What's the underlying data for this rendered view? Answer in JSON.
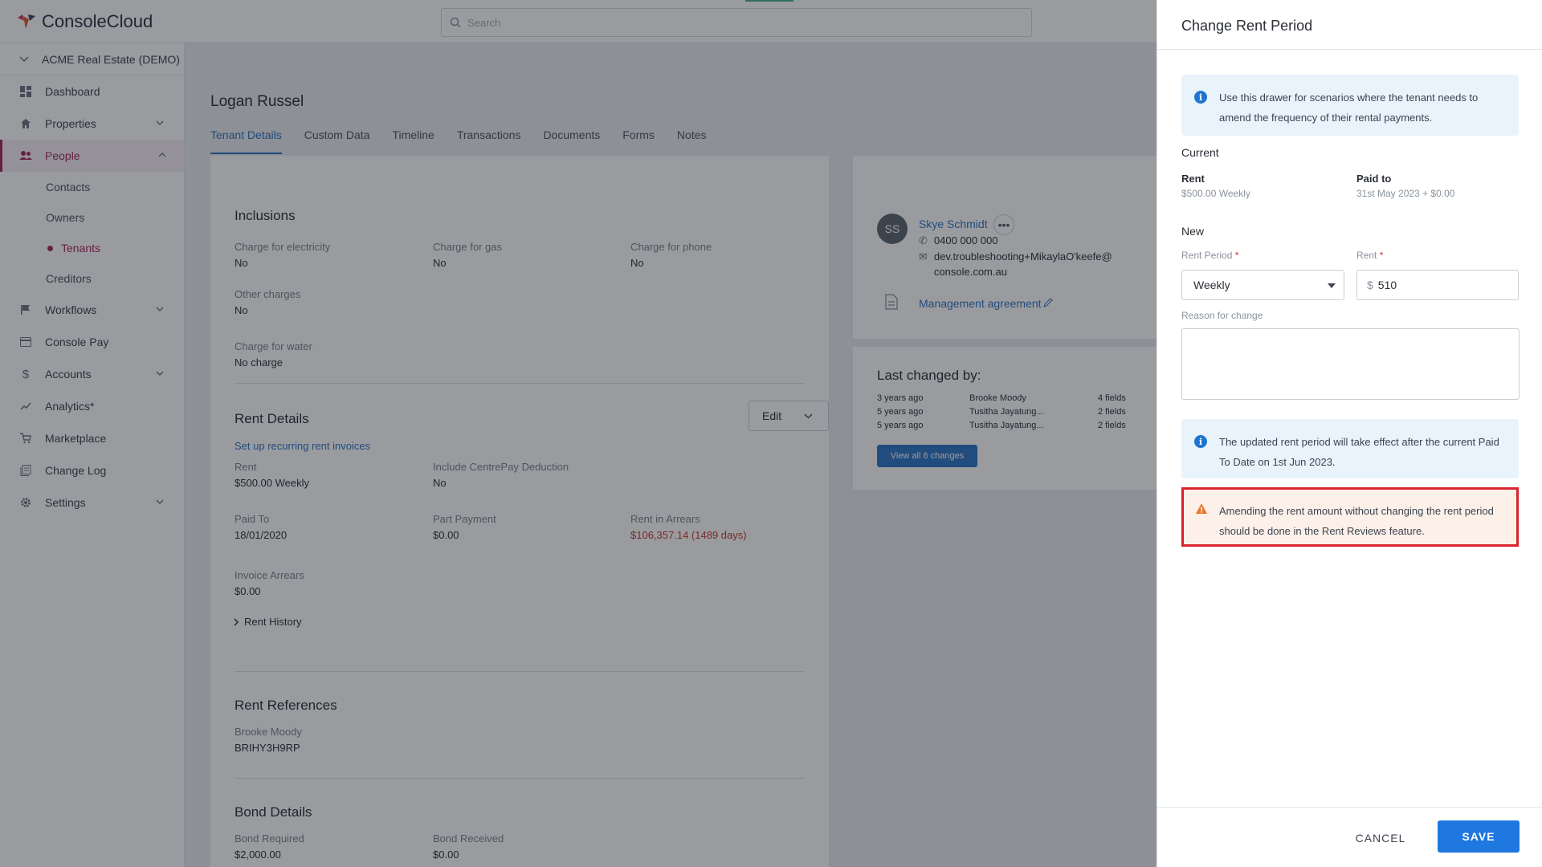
{
  "app": {
    "name": "ConsoleCloud"
  },
  "search": {
    "placeholder": "Search"
  },
  "sidebar": {
    "company": "ACME Real Estate (DEMO)",
    "items": [
      {
        "label": "Dashboard",
        "icon": "dashboard-icon"
      },
      {
        "label": "Properties",
        "icon": "home-icon"
      },
      {
        "label": "People",
        "icon": "people-icon"
      },
      {
        "label": "Workflows",
        "icon": "flag-icon"
      },
      {
        "label": "Console Pay",
        "icon": "card-icon"
      },
      {
        "label": "Accounts",
        "icon": "dollar-icon"
      },
      {
        "label": "Analytics*",
        "icon": "trend-icon"
      },
      {
        "label": "Marketplace",
        "icon": "cart-icon"
      },
      {
        "label": "Change Log",
        "icon": "log-icon"
      },
      {
        "label": "Settings",
        "icon": "gear-icon"
      }
    ],
    "people_sub": [
      "Contacts",
      "Owners",
      "Tenants",
      "Creditors"
    ]
  },
  "page": {
    "title": "Logan Russel",
    "tabs": [
      "Tenant Details",
      "Custom Data",
      "Timeline",
      "Transactions",
      "Documents",
      "Forms",
      "Notes"
    ]
  },
  "inclusions": {
    "title": "Inclusions",
    "electricity": {
      "label": "Charge for electricity",
      "value": "No"
    },
    "gas": {
      "label": "Charge for gas",
      "value": "No"
    },
    "phone": {
      "label": "Charge for phone",
      "value": "No"
    },
    "other": {
      "label": "Other charges",
      "value": "No"
    },
    "water": {
      "label": "Charge for water",
      "value": "No charge"
    }
  },
  "rent_details": {
    "title": "Rent Details",
    "edit_label": "Edit",
    "setup_link": "Set up recurring rent invoices",
    "rent": {
      "label": "Rent",
      "value": "$500.00 Weekly"
    },
    "centrepay": {
      "label": "Include CentrePay Deduction",
      "value": "No"
    },
    "paid_to": {
      "label": "Paid To",
      "value": "18/01/2020"
    },
    "part_payment": {
      "label": "Part Payment",
      "value": "$0.00"
    },
    "arrears": {
      "label": "Rent in Arrears",
      "value": "$106,357.14 (1489 days)"
    },
    "invoice_arrears": {
      "label": "Invoice Arrears",
      "value": "$0.00"
    },
    "history": "Rent History"
  },
  "rent_references": {
    "title": "Rent References",
    "name": "Brooke Moody",
    "ref": "BRIHY3H9RP"
  },
  "bond": {
    "title": "Bond Details",
    "required": {
      "label": "Bond Required",
      "value": "$2,000.00"
    },
    "received": {
      "label": "Bond Received",
      "value": "$0.00"
    }
  },
  "owners": {
    "initials": "SS",
    "name": "Skye Schmidt",
    "phone": "0400 000 000",
    "email_1": "dev.troubleshooting+MikaylaO'keefe@",
    "email_2": "console.com.au",
    "agreement": "Management agreement"
  },
  "last_changed": {
    "title": "Last changed by:",
    "rows": [
      {
        "when": "3 years ago",
        "who": "Brooke Moody",
        "fields": "4 fields"
      },
      {
        "when": "5 years ago",
        "who": "Tusitha Jayatung...",
        "fields": "2 fields"
      },
      {
        "when": "5 years ago",
        "who": "Tusitha Jayatung...",
        "fields": "2 fields"
      }
    ],
    "button": "View all 6 changes"
  },
  "drawer": {
    "title": "Change Rent Period",
    "info_1": "Use this drawer for scenarios where the tenant needs to amend the frequency of their rental payments.",
    "current_title": "Current",
    "current_rent_label": "Rent",
    "current_rent_value": "$500.00  Weekly",
    "paid_to_label": "Paid to",
    "paid_to_value": "31st May 2023 + $0.00",
    "new_title": "New",
    "rent_period_label": "Rent Period",
    "rent_period_value": "Weekly",
    "rent_label": "Rent",
    "rent_currency": "$",
    "rent_value": "510",
    "reason_label": "Reason for change",
    "info_2": "The updated rent period will take effect after the current Paid To Date on 1st Jun 2023.",
    "warning": "Amending the rent amount without changing the rent period should be done in the Rent Reviews feature.",
    "cancel": "CANCEL",
    "save": "SAVE"
  },
  "colors": {
    "brand": "#a3285a",
    "link": "#2b75c5",
    "primary_button": "#1e78e0",
    "danger": "#d9232d"
  }
}
